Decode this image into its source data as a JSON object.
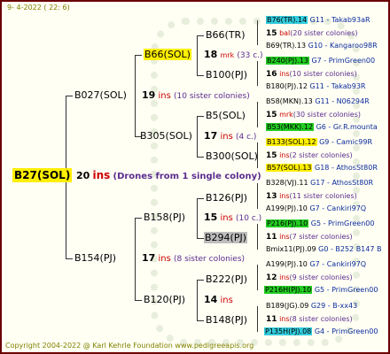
{
  "date": "9-  4-2022 ( 22:  6)",
  "footer": "Copyright 2004-2022 @ Karl Kehrle Foundation    www.pedigreeapis.org",
  "colors": {
    "highlight_yellow": "#ffef00",
    "highlight_green": "#22cc22",
    "highlight_cyan": "#33ccdd",
    "highlight_gray": "#bdbdbd",
    "ins_red": "#cc0000",
    "note_purple": "#5b2c8f",
    "frame": "#6a0000"
  },
  "root": {
    "name": "B27(SOL)",
    "num": "20",
    "unit": "ins",
    "note": "(Drones from 1 single colony)"
  },
  "g2": [
    {
      "name": "B027(SOL)",
      "num": "19",
      "unit": "ins",
      "note": "(10 sister colonies)"
    },
    {
      "name": "B154(PJ)",
      "num": "17",
      "unit": "ins",
      "note": "(8 sister colonies)"
    }
  ],
  "g3": [
    {
      "name": "B66(SOL)",
      "num": "18",
      "unit": "mrk",
      "note": "(33 c.)"
    },
    {
      "name": "B305(SOL)",
      "num": "17",
      "unit": "ins",
      "note": "(4 c.)"
    },
    {
      "name": "B158(PJ)",
      "num": "15",
      "unit": "ins",
      "note": "(10 c.)"
    },
    {
      "name": "B120(PJ)",
      "num": "14",
      "unit": "ins"
    }
  ],
  "g4": [
    "B66(TR)",
    "B100(PJ)",
    "B5(SOL)",
    "B300(SOL)",
    "B126(PJ)",
    "B294(PJ)",
    "B222(PJ)",
    "B148(PJ)"
  ],
  "g5": [
    {
      "id": "B76(TR).14",
      "info": "G11 - Takab93aR"
    },
    {
      "num": "15",
      "unit": "bal",
      "note": "(20 sister colonies)"
    },
    {
      "id": "B69(TR).13",
      "info": "G10 - Kangaroo98R"
    },
    {
      "id": "B240(PJ).13",
      "info": "G7 - PrimGreen00"
    },
    {
      "num": "16",
      "unit": "ins",
      "note": "(10 sister colonies)"
    },
    {
      "id": "B180(PJ).12",
      "info": "G11 - Takab93R"
    },
    {
      "id": "B58(MKN).13",
      "info": "G11 - N06294R"
    },
    {
      "num": "15",
      "unit": "mrk",
      "note": "(30 sister colonies)"
    },
    {
      "id": "B53(MKK).12",
      "info": "G6 - Gr.R.mounta"
    },
    {
      "id": "B133(SOL).12",
      "info": "G9 - Camic99R"
    },
    {
      "num": "15",
      "unit": "ins",
      "note": "(2 sister colonies)"
    },
    {
      "id": "B57(SOL).13",
      "info": "G18 - AthosSt80R"
    },
    {
      "id": "B328(VJ).11",
      "info": "G17 - AthosSt80R"
    },
    {
      "num": "13",
      "unit": "ins",
      "note": "(11 sister colonies)"
    },
    {
      "id": "A199(PJ).10",
      "info": "G7 - Cankiri97Q"
    },
    {
      "id": "P216(PJ).10",
      "info": "G5 - PrimGreen00"
    },
    {
      "num": "11",
      "unit": "ins",
      "note": "(7 sister colonies)"
    },
    {
      "id": "Bmix11(PJ).09",
      "info": "G0 - B252 B147 B"
    },
    {
      "id": "A199(PJ).10",
      "info": "G7 - Cankiri97Q"
    },
    {
      "num": "12",
      "unit": "ins",
      "note": "(9 sister colonies)"
    },
    {
      "id": "P216H(PJ).10",
      "info": "G5 - PrimGreen00"
    },
    {
      "id": "B189(JG).09",
      "info": "G29 - B-xx43"
    },
    {
      "num": "11",
      "unit": "ins",
      "note": "(8 sister colonies)"
    },
    {
      "id": "P135H(PJ).08",
      "info": "G4 - PrimGreen00"
    }
  ]
}
